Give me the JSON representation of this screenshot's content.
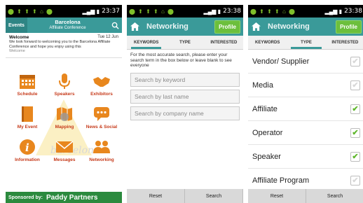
{
  "status": {
    "p1_time": "23:37",
    "p2_time": "23:38",
    "p3_time": "23:38"
  },
  "home": {
    "events_label": "Events",
    "title_line1": "Barcelona",
    "title_line2": "Affiliate Conference",
    "welcome_title": "Welcome",
    "welcome_date": "Tue 12 Jun",
    "welcome_text": "We look forward to welcoming you to the Barcelona Affiliate Conference and hope you enjoy using this",
    "welcome_more": "Welcome",
    "icons": [
      {
        "label": "Schedule",
        "icon": "calendar-icon"
      },
      {
        "label": "Speakers",
        "icon": "microphone-icon"
      },
      {
        "label": "Exhibitors",
        "icon": "handshake-icon"
      },
      {
        "label": "My Event",
        "icon": "book-icon"
      },
      {
        "label": "Mapping",
        "icon": "map-icon"
      },
      {
        "label": "News & Social",
        "icon": "chat-icon"
      },
      {
        "label": "Information",
        "icon": "info-icon"
      },
      {
        "label": "Messages",
        "icon": "envelope-icon"
      },
      {
        "label": "Networking",
        "icon": "people-icon"
      }
    ],
    "sponsor_label": "Sponsored by:",
    "sponsor_name": "Paddy Partners"
  },
  "networking": {
    "title": "Networking",
    "profile_button": "Profile",
    "tabs": [
      "KEYWORDS",
      "TYPE",
      "INTERESTED"
    ],
    "hint": "For the most accurate search, please enter your search term in the box below or leave blank to see everyone",
    "keyword_placeholder": "Search by keyword",
    "lastname_placeholder": "Search by last name",
    "company_placeholder": "Search by company name",
    "reset_button": "Reset",
    "search_button": "Search"
  },
  "types": {
    "title": "Networking",
    "profile_button": "Profile",
    "tabs": [
      "KEYWORDS",
      "TYPE",
      "INTERESTED"
    ],
    "items": [
      {
        "label": "Vendor/ Supplier",
        "checked": false
      },
      {
        "label": "Media",
        "checked": false
      },
      {
        "label": "Affiliate",
        "checked": true
      },
      {
        "label": "Operator",
        "checked": true
      },
      {
        "label": "Speaker",
        "checked": true
      },
      {
        "label": "Affiliate Program",
        "checked": false
      }
    ],
    "reset_button": "Reset",
    "search_button": "Search"
  },
  "colors": {
    "teal": "#3a9a99",
    "profile_green": "#6cbf3c",
    "icon_orange": "#e8871e",
    "label_red": "#c63a1a",
    "sponsor_green": "#2b8a3e"
  }
}
